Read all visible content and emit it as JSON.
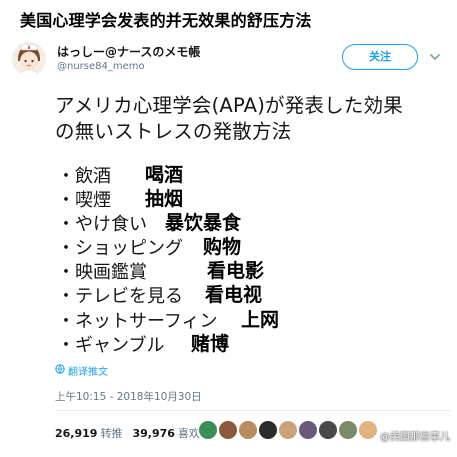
{
  "banner": {
    "title": "美国心理学会发表的并无效果的舒压方法"
  },
  "user": {
    "name": "はっしー@ナースのメモ帳",
    "handle": "@nurse84_memo",
    "follow_label": "关注"
  },
  "tweet": {
    "line1": "アメリカ心理学会(APA)が発表した効果",
    "line2": "の無いストレスの発散方法",
    "items": [
      {
        "jp": "・飲酒",
        "cn": "喝酒"
      },
      {
        "jp": "・喫煙",
        "cn": "抽烟"
      },
      {
        "jp": "・やけ食い",
        "cn": "暴饮暴食"
      },
      {
        "jp": "・ショッピング",
        "cn": "购物"
      },
      {
        "jp": "・映画鑑賞",
        "cn": "看电影"
      },
      {
        "jp": "・テレビを見る",
        "cn": "看电视"
      },
      {
        "jp": "・ネットサーフィン",
        "cn": "上网"
      },
      {
        "jp": "・ギャンブル",
        "cn": "赌博"
      }
    ],
    "translate_label": "翻译推文",
    "timestamp": "上午10:15 - 2018年10月30日"
  },
  "stats": {
    "retweets": "26,919",
    "retweets_label": "转推",
    "likes": "39,976",
    "likes_label": "喜欢"
  },
  "watermark": "@美国那些事儿",
  "colors": {
    "accent": "#1da1f2",
    "muted": "#657786",
    "text": "#14171a"
  }
}
